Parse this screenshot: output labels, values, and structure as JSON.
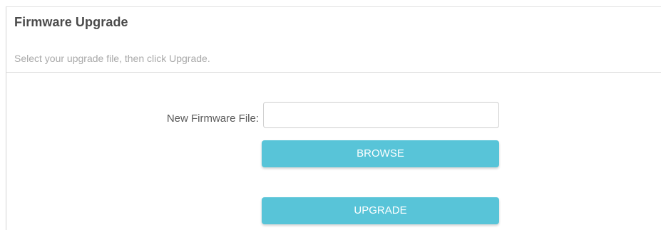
{
  "section": {
    "title": "Firmware Upgrade",
    "description": "Select your upgrade file, then click Upgrade."
  },
  "form": {
    "file_label": "New Firmware File:",
    "file_value": "",
    "browse_label": "BROWSE",
    "upgrade_label": "UPGRADE"
  },
  "colors": {
    "button_bg": "#58c4d8",
    "button_text": "#ffffff",
    "title_text": "#4a4a4a",
    "description_text": "#a9a9a9"
  }
}
